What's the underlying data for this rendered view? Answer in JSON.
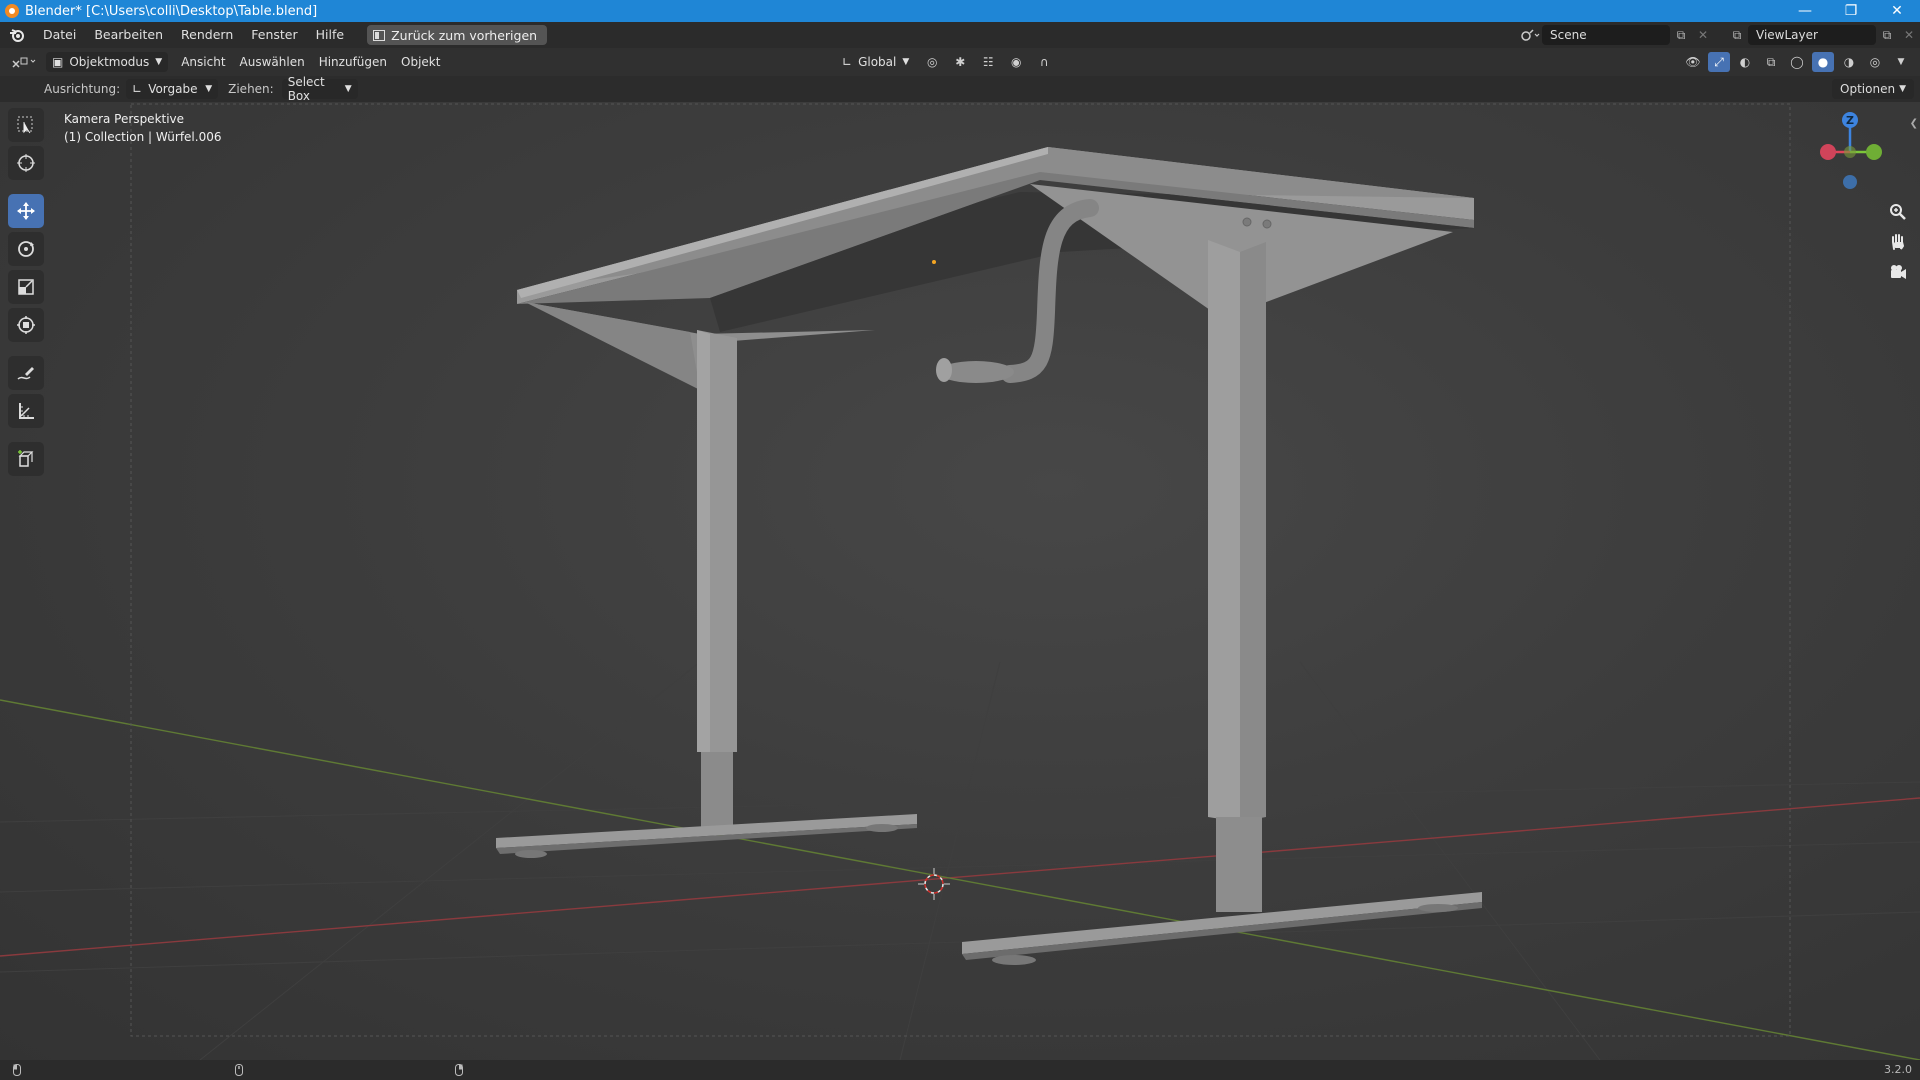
{
  "window": {
    "title": "Blender* [C:\\Users\\colli\\Desktop\\Table.blend]",
    "controls": [
      "minimize",
      "restore",
      "close"
    ]
  },
  "menubar": {
    "items": [
      "Datei",
      "Bearbeiten",
      "Rendern",
      "Fenster",
      "Hilfe"
    ],
    "back_button": "Zurück zum vorherigen",
    "scene": "Scene",
    "view_layer": "ViewLayer"
  },
  "header": {
    "mode": "Objektmodus",
    "menus": [
      "Ansicht",
      "Auswählen",
      "Hinzufügen",
      "Objekt"
    ],
    "transform_orientation": "Global"
  },
  "tool_settings": {
    "orientation_label": "Ausrichtung:",
    "orientation_value": "Vorgabe",
    "drag_label": "Ziehen:",
    "drag_value": "Select Box",
    "options": "Optionen"
  },
  "viewport": {
    "camera_label": "Kamera Perspektive",
    "collection_label": "(1) Collection | Würfel.006",
    "gizmo_axes": {
      "z": "Z",
      "x_color": "#e0445a",
      "y_color": "#7cc63a",
      "z_color": "#3d84e0"
    }
  },
  "toolbar": {
    "tools": [
      "select-box",
      "cursor",
      "move",
      "rotate",
      "scale",
      "transform",
      "annotate",
      "measure",
      "add-cube"
    ],
    "active": "move"
  },
  "statusbar": {
    "version": "3.2.0"
  },
  "colors": {
    "accent": "#4772b3",
    "titlebar": "#1f86d6",
    "axis_x": "#c2484e",
    "axis_y": "#7a9a3a"
  }
}
